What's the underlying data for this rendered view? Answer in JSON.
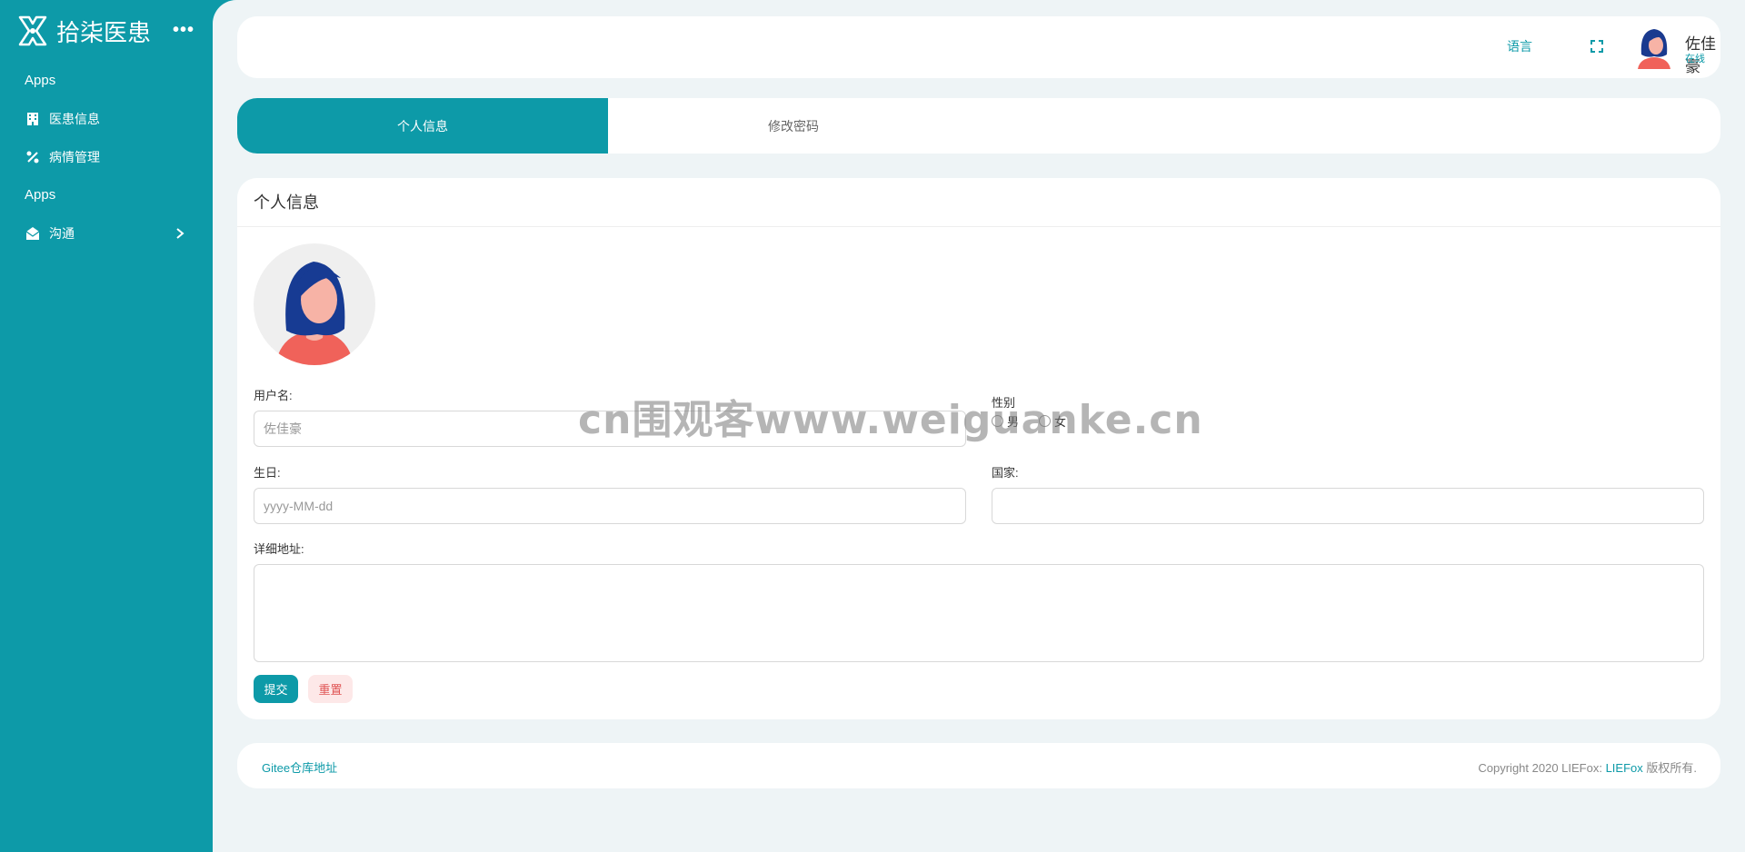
{
  "brand": {
    "name": "拾柒医患",
    "more_label": "•••"
  },
  "sidebar": {
    "sections": [
      {
        "title": "Apps",
        "items": [
          {
            "label": "医患信息",
            "icon": "building-icon"
          },
          {
            "label": "病情管理",
            "icon": "percent-icon"
          }
        ]
      },
      {
        "title": "Apps",
        "items": [
          {
            "label": "沟通",
            "icon": "envelope-icon",
            "has_children": true
          }
        ]
      }
    ]
  },
  "header": {
    "language_label": "语言",
    "user_name": "佐佳豪",
    "user_status": "在线"
  },
  "tabs": [
    {
      "label": "个人信息",
      "active": true
    },
    {
      "label": "修改密码",
      "active": false
    }
  ],
  "form": {
    "title": "个人信息",
    "username_label": "用户名:",
    "username_placeholder": "佐佳豪",
    "gender_label": "性别",
    "gender_options": [
      "男",
      "女"
    ],
    "birthday_label": "生日:",
    "birthday_placeholder": "yyyy-MM-dd",
    "country_label": "国家:",
    "country_value": "",
    "address_label": "详细地址:",
    "address_value": "",
    "submit_label": "提交",
    "reset_label": "重置"
  },
  "footer": {
    "repo_link": "Gitee仓库地址",
    "copyright_prefix": "Copyright 2020 LIEFox:",
    "copyright_brand": "LIEFox",
    "copyright_suffix": " 版权所有."
  },
  "watermark": "cn围观客www.weiguanke.cn",
  "colors": {
    "accent": "#0d9aa8",
    "background": "#eef4f6",
    "danger": "#e05555"
  }
}
